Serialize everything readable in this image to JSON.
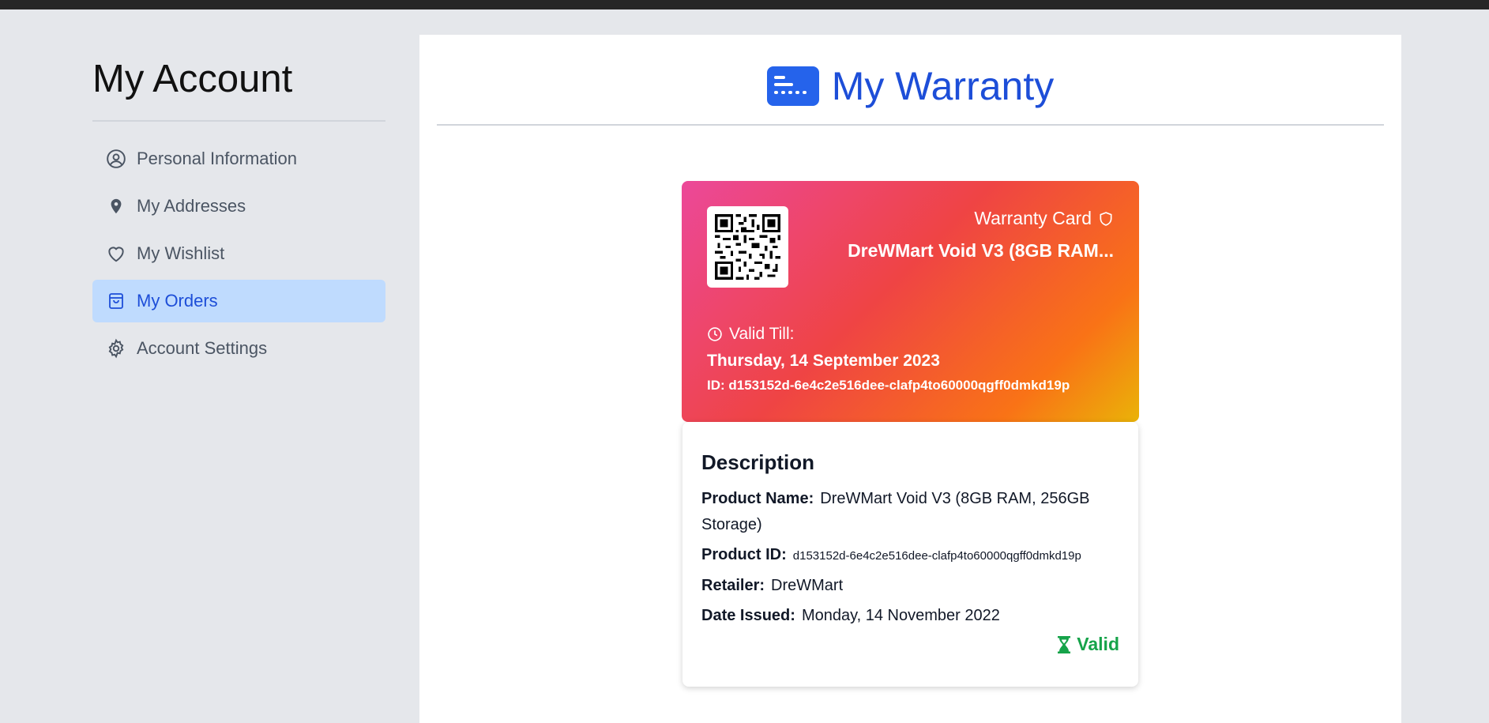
{
  "sidebar": {
    "title": "My Account",
    "items": [
      {
        "label": "Personal Information",
        "icon": "user-circle-icon",
        "active": false
      },
      {
        "label": "My Addresses",
        "icon": "map-pin-icon",
        "active": false
      },
      {
        "label": "My Wishlist",
        "icon": "heart-icon",
        "active": false
      },
      {
        "label": "My Orders",
        "icon": "shopping-bag-icon",
        "active": true
      },
      {
        "label": "Account Settings",
        "icon": "gear-icon",
        "active": false
      }
    ]
  },
  "main": {
    "title": "My Warranty",
    "icon": "warranty-card-icon"
  },
  "card": {
    "type_label": "Warranty Card",
    "product_short": "DreWMart Void V3 (8GB RAM...",
    "valid_label": "Valid Till:",
    "valid_date": "Thursday, 14 September 2023",
    "id_text": "ID: d153152d-6e4c2e516dee-clafp4to60000qgff0dmkd19p"
  },
  "description": {
    "heading": "Description",
    "product_name_label": "Product Name:",
    "product_name": "DreWMart Void V3 (8GB RAM, 256GB Storage)",
    "product_id_label": "Product ID:",
    "product_id": "d153152d-6e4c2e516dee-clafp4to60000qgff0dmkd19p",
    "retailer_label": "Retailer:",
    "retailer": "DreWMart",
    "date_issued_label": "Date Issued:",
    "date_issued": "Monday, 14 November 2022",
    "status": "Valid"
  },
  "colors": {
    "accent": "#1d4ed8",
    "active_bg": "#bfdbfe",
    "status_green": "#16a34a",
    "card_gradient": [
      "#ec4899",
      "#ef4444",
      "#f97316",
      "#eab308"
    ]
  }
}
